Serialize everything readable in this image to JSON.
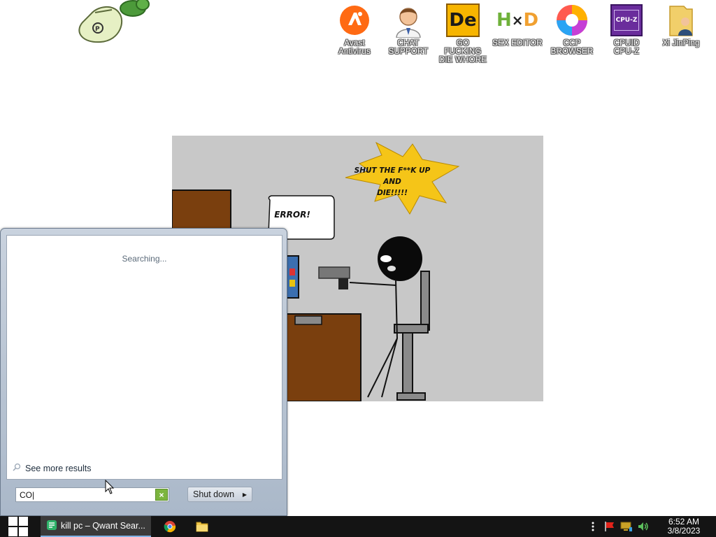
{
  "desktop": {
    "icons": [
      {
        "id": "avast",
        "label": "Avast\nAntivirus",
        "icon": "avast-icon"
      },
      {
        "id": "chat-support",
        "label": "CHAT\nSUPPORT",
        "icon": "support-agent-icon"
      },
      {
        "id": "gfdw",
        "label": "GO FUCKING\nDIE WHORE",
        "icon": "de-icon"
      },
      {
        "id": "sex-editor",
        "label": "SEX EDITOR",
        "icon": "hxd-icon"
      },
      {
        "id": "ccp-browser",
        "label": "CCP\nBROWSER",
        "icon": "browser-icon"
      },
      {
        "id": "cpuz",
        "label": "CPUID\nCPU-Z",
        "icon": "cpuz-icon"
      },
      {
        "id": "xi-jinping",
        "label": "Xi JinPing",
        "icon": "user-folder-icon"
      }
    ],
    "icon_texts": {
      "de": "De",
      "cpuz": "CPU-Z",
      "hxd_h": "H",
      "hxd_d": "D"
    }
  },
  "comic": {
    "shout": "SHUT THE F**K UP\nAND\nDIE!!!!!",
    "error": "ERROR!",
    "colors": {
      "background": "#c8c8c8",
      "desk": "#7a3f0e",
      "burst": "#f5c518"
    }
  },
  "start_menu": {
    "searching_text": "Searching...",
    "see_more": "See more results",
    "search_value": "CO|",
    "clear_symbol": "×",
    "shutdown_label": "Shut down",
    "shutdown_arrow": "▶"
  },
  "taskbar": {
    "tasks": [
      {
        "label": "kill pc – Qwant Sear...",
        "icon": "qwant-icon",
        "active": true
      },
      {
        "label": "",
        "icon": "chrome-icon",
        "active": false
      },
      {
        "label": "",
        "icon": "file-explorer-icon",
        "active": false
      }
    ],
    "clock": {
      "time": "6:52 AM",
      "date": "3/8/2023"
    },
    "colors": {
      "background": "#141414",
      "active_task": "#3a3a3a",
      "accent": "#7fb2e5"
    }
  }
}
